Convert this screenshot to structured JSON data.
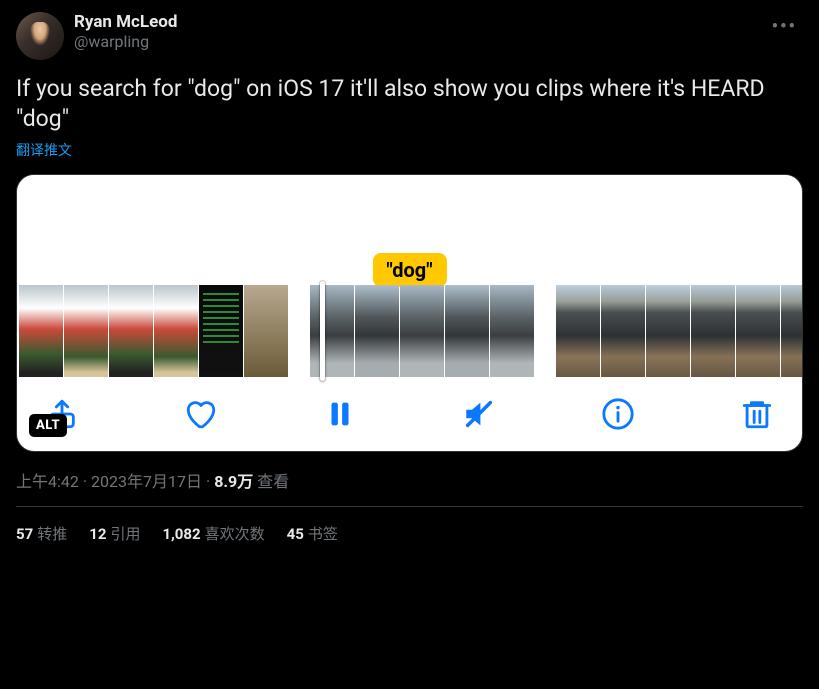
{
  "author": {
    "display_name": "Ryan McLeod",
    "handle": "@warpling"
  },
  "tweet_text": "If you search for \"dog\" on iOS 17 it'll also show you clips where it's HEARD \"dog\"",
  "translate_label": "翻译推文",
  "media": {
    "search_label": "\"dog\"",
    "alt_badge": "ALT"
  },
  "meta": {
    "time": "上午4:42",
    "date": "2023年7月17日",
    "views_count": "8.9万",
    "views_label": "查看"
  },
  "stats": {
    "retweets": {
      "count": "57",
      "label": "转推"
    },
    "quotes": {
      "count": "12",
      "label": "引用"
    },
    "likes": {
      "count": "1,082",
      "label": "喜欢次数"
    },
    "bookmarks": {
      "count": "45",
      "label": "书签"
    }
  }
}
